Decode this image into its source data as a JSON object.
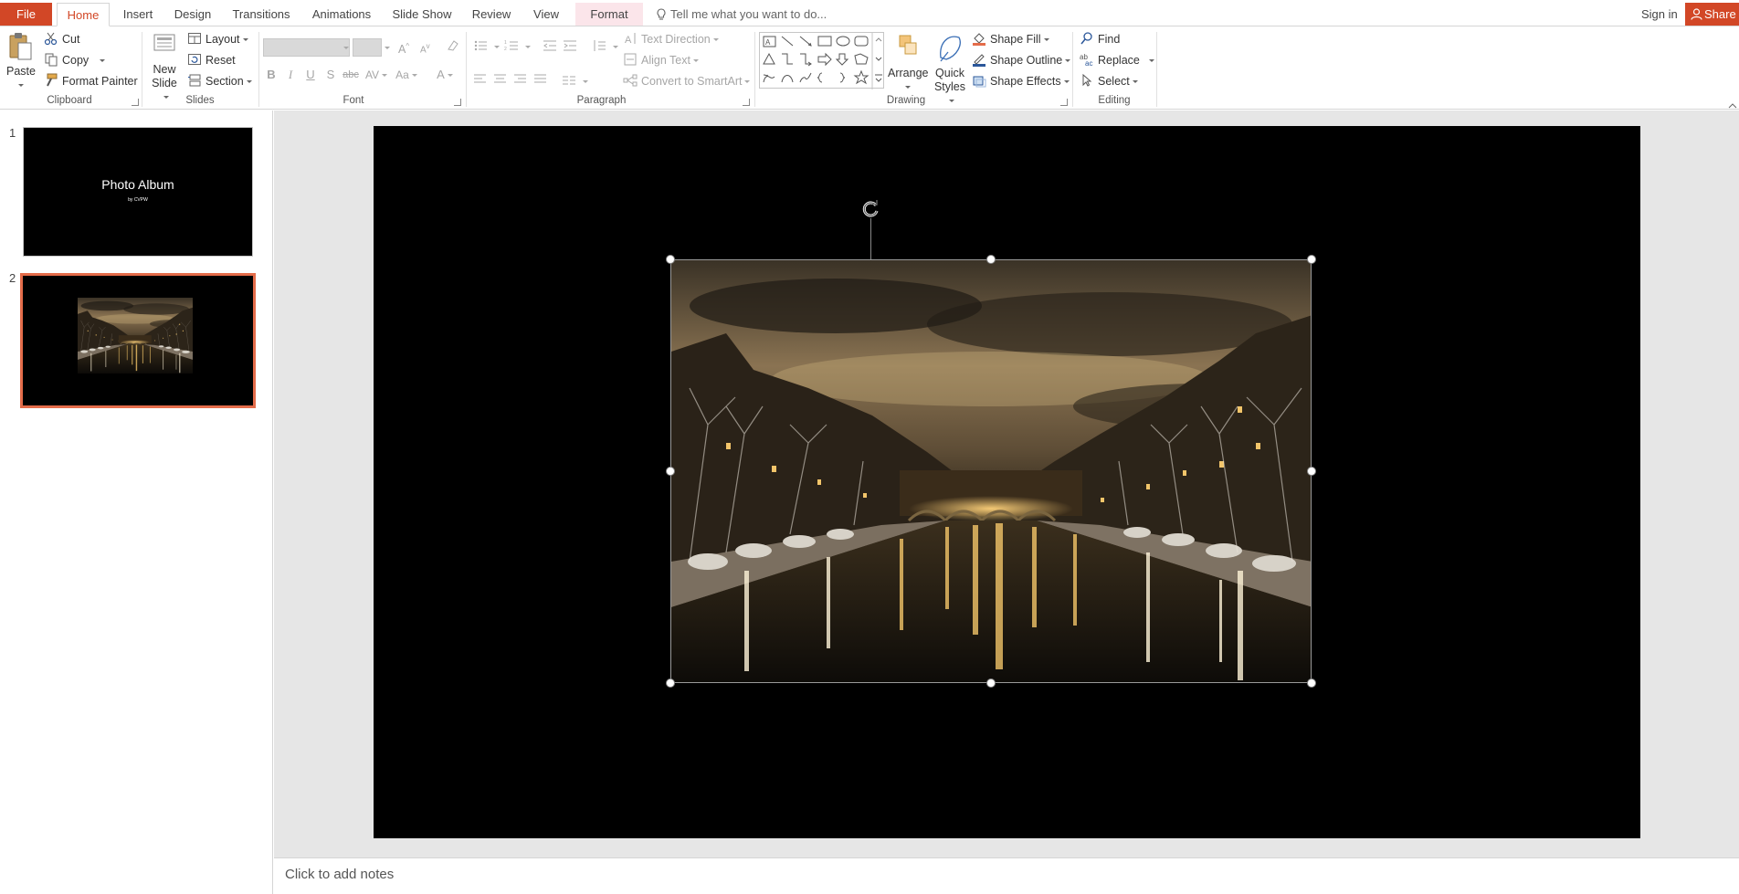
{
  "tabs": {
    "file": "File",
    "home": "Home",
    "insert": "Insert",
    "design": "Design",
    "transitions": "Transitions",
    "animations": "Animations",
    "slideshow": "Slide Show",
    "review": "Review",
    "view": "View",
    "format": "Format"
  },
  "tellme_placeholder": "Tell me what you want to do...",
  "signin": "Sign in",
  "share": "Share",
  "ribbon": {
    "clipboard": {
      "label": "Clipboard",
      "paste": "Paste",
      "cut": "Cut",
      "copy": "Copy",
      "format_painter": "Format Painter"
    },
    "slides": {
      "label": "Slides",
      "new_slide_1": "New",
      "new_slide_2": "Slide",
      "layout": "Layout",
      "reset": "Reset",
      "section": "Section"
    },
    "font": {
      "label": "Font"
    },
    "paragraph": {
      "label": "Paragraph",
      "text_direction": "Text Direction",
      "align_text": "Align Text",
      "convert_smartart": "Convert to SmartArt"
    },
    "drawing": {
      "label": "Drawing",
      "arrange": "Arrange",
      "quick_1": "Quick",
      "quick_2": "Styles",
      "shape_fill": "Shape Fill",
      "shape_outline": "Shape Outline",
      "shape_effects": "Shape Effects"
    },
    "editing": {
      "label": "Editing",
      "find": "Find",
      "replace": "Replace",
      "select": "Select"
    }
  },
  "slides": [
    {
      "number": "1",
      "title": "Photo Album",
      "subtitle": "by CVPW"
    },
    {
      "number": "2"
    }
  ],
  "notes_placeholder": "Click to add notes",
  "colors": {
    "accent": "#d24726",
    "selection": "#e46c4a"
  }
}
